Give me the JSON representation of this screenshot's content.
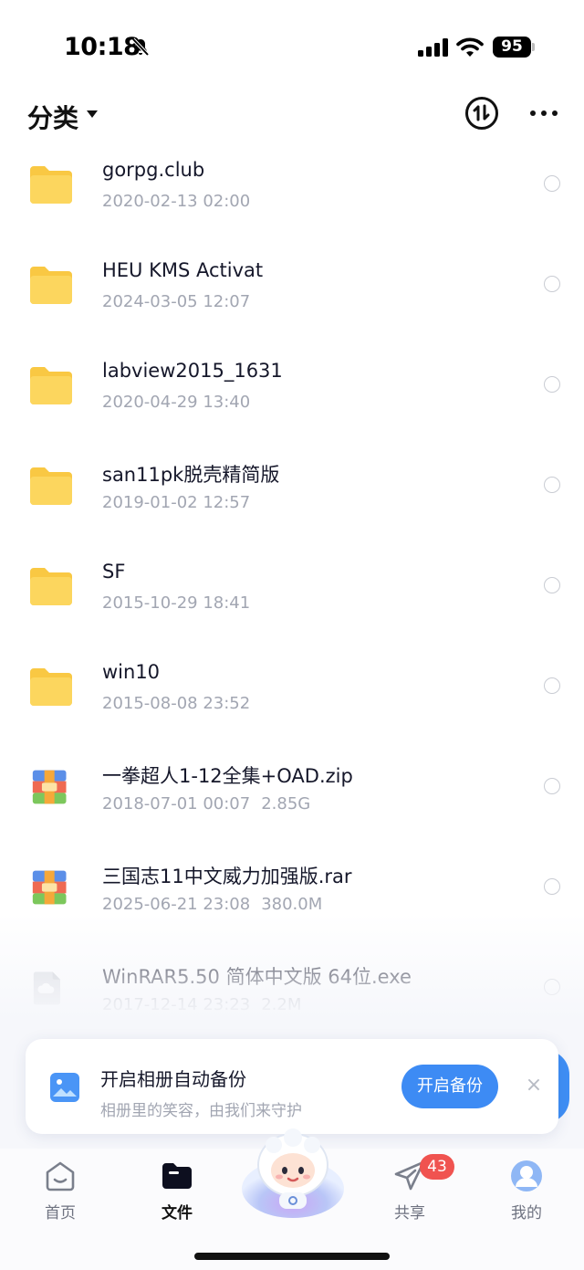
{
  "status_bar": {
    "time": "10:18",
    "battery": "95"
  },
  "header": {
    "title": "分类"
  },
  "files": [
    {
      "name": "gorpg.club",
      "date": "2020-02-13 02:00",
      "size": "",
      "kind": "folder"
    },
    {
      "name": "HEU KMS Activat",
      "date": "2024-03-05 12:07",
      "size": "",
      "kind": "folder"
    },
    {
      "name": "labview2015_1631",
      "date": "2020-04-29 13:40",
      "size": "",
      "kind": "folder"
    },
    {
      "name": "san11pk脱壳精简版",
      "date": "2019-01-02 12:57",
      "size": "",
      "kind": "folder"
    },
    {
      "name": "SF",
      "date": "2015-10-29 18:41",
      "size": "",
      "kind": "folder"
    },
    {
      "name": "win10",
      "date": "2015-08-08 23:52",
      "size": "",
      "kind": "folder"
    },
    {
      "name": "一拳超人1-12全集+OAD.zip",
      "date": "2018-07-01 00:07",
      "size": "2.85G",
      "kind": "archive"
    },
    {
      "name": "三国志11中文威力加强版.rar",
      "date": "2025-06-21 23:08",
      "size": "380.0M",
      "kind": "archive"
    },
    {
      "name": "WinRAR5.50 简体中文版 64位.exe",
      "date": "2017-12-14 23:23",
      "size": "2.2M",
      "kind": "file"
    }
  ],
  "backup": {
    "title": "开启相册自动备份",
    "subtitle": "相册里的笑容，由我们来守护",
    "button": "开启备份",
    "close": "×"
  },
  "tabs": [
    {
      "label": "首页"
    },
    {
      "label": "文件"
    },
    {
      "label": "共享",
      "badge": "43"
    },
    {
      "label": "我的"
    }
  ],
  "colors": {
    "accent": "#3d8bf4",
    "folder": "#fcd45a",
    "badge": "#f05350"
  }
}
